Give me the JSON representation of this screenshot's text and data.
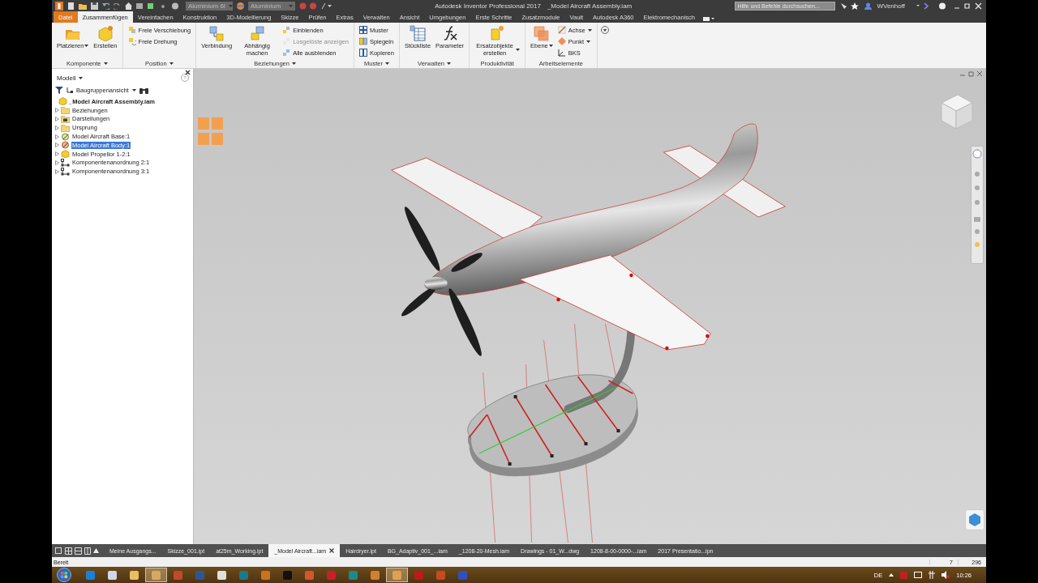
{
  "window": {
    "title": "Autodesk Inventor Professional 2017",
    "document": "_Model Aircraft Assembly.iam"
  },
  "quick_access": {
    "material": "Aluminium 6l",
    "appearance": "Aluminium"
  },
  "search": {
    "placeholder": "Hilfe und Befehle durchsuchen..."
  },
  "user": {
    "name": "WVenhoff"
  },
  "tabs": [
    {
      "label": "Datei",
      "kind": "file",
      "selected": false
    },
    {
      "label": "Zusammenfügen",
      "kind": "tab",
      "selected": true
    },
    {
      "label": "Vereinfachen",
      "kind": "tab",
      "selected": false
    },
    {
      "label": "Konstruktion",
      "kind": "tab",
      "selected": false
    },
    {
      "label": "3D-Modellierung",
      "kind": "tab",
      "selected": false
    },
    {
      "label": "Skizze",
      "kind": "tab",
      "selected": false
    },
    {
      "label": "Prüfen",
      "kind": "tab",
      "selected": false
    },
    {
      "label": "Extras",
      "kind": "tab",
      "selected": false
    },
    {
      "label": "Verwalten",
      "kind": "tab",
      "selected": false
    },
    {
      "label": "Ansicht",
      "kind": "tab",
      "selected": false
    },
    {
      "label": "Umgebungen",
      "kind": "tab",
      "selected": false
    },
    {
      "label": "Erste Schritte",
      "kind": "tab",
      "selected": false
    },
    {
      "label": "Zusatzmodule",
      "kind": "tab",
      "selected": false
    },
    {
      "label": "Vault",
      "kind": "tab",
      "selected": false
    },
    {
      "label": "Autodesk A360",
      "kind": "tab",
      "selected": false
    },
    {
      "label": "Elektromechanisch",
      "kind": "tab",
      "selected": false
    }
  ],
  "ribbon": {
    "panels": [
      {
        "title": "Komponente",
        "dropdown": true,
        "tools": [
          {
            "label": "Platzieren",
            "kind": "large",
            "dropdown": true,
            "disabled": false
          },
          {
            "label": "Erstellen",
            "kind": "large",
            "dropdown": false,
            "disabled": false
          }
        ]
      },
      {
        "title": "Position",
        "dropdown": true,
        "tools": [
          {
            "label": "Freie Verschiebung",
            "kind": "small",
            "dropdown": false,
            "disabled": false
          },
          {
            "label": "Freie Drehung",
            "kind": "small",
            "dropdown": false,
            "disabled": false
          }
        ]
      },
      {
        "title": "Beziehungen",
        "dropdown": true,
        "tools": [
          {
            "label": "Verbindung",
            "kind": "large",
            "dropdown": false,
            "disabled": false
          },
          {
            "label": "Abhängig machen",
            "kind": "large",
            "dropdown": false,
            "disabled": false
          },
          {
            "label": "Einblenden",
            "kind": "small",
            "dropdown": false,
            "disabled": false
          },
          {
            "label": "Losgelöste anzeigen",
            "kind": "small",
            "dropdown": false,
            "disabled": true
          },
          {
            "label": "Alle ausblenden",
            "kind": "small",
            "dropdown": false,
            "disabled": false
          }
        ]
      },
      {
        "title": "Muster",
        "dropdown": true,
        "tools": [
          {
            "label": "Muster",
            "kind": "small",
            "dropdown": false,
            "disabled": false
          },
          {
            "label": "Spiegeln",
            "kind": "small",
            "dropdown": false,
            "disabled": false
          },
          {
            "label": "Kopieren",
            "kind": "small",
            "dropdown": false,
            "disabled": false
          }
        ]
      },
      {
        "title": "Verwalten",
        "dropdown": true,
        "tools": [
          {
            "label": "Stückliste",
            "kind": "large",
            "dropdown": false,
            "disabled": false
          },
          {
            "label": "Parameter",
            "kind": "large",
            "dropdown": false,
            "disabled": false
          }
        ]
      },
      {
        "title": "Produktivität",
        "dropdown": false,
        "tools": [
          {
            "label": "Ersatzobjekte erstellen",
            "kind": "large",
            "dropdown": true,
            "disabled": false
          }
        ]
      },
      {
        "title": "Arbeitselemente",
        "dropdown": false,
        "tools": [
          {
            "label": "Ebene",
            "kind": "large",
            "dropdown": true,
            "disabled": false
          },
          {
            "label": "Achse",
            "kind": "small",
            "dropdown": true,
            "disabled": false
          },
          {
            "label": "Punkt",
            "kind": "small",
            "dropdown": true,
            "disabled": false
          },
          {
            "label": "BKS",
            "kind": "small",
            "dropdown": false,
            "disabled": false
          }
        ]
      }
    ]
  },
  "browser": {
    "title": "Modell",
    "help": "?",
    "view": "Baugruppenansicht",
    "tree": {
      "label": "_Model Aircraft Assembly.iam",
      "children": [
        {
          "label": "Beziehungen",
          "kind": "folder",
          "expanded": false,
          "selected": false
        },
        {
          "label": "Darstellungen",
          "kind": "representations",
          "expanded": false,
          "selected": false
        },
        {
          "label": "Ursprung",
          "kind": "folder",
          "expanded": false,
          "selected": false
        },
        {
          "label": "Model Aircraft Base:1",
          "kind": "part",
          "expanded": false,
          "selected": false
        },
        {
          "label": "Model Aircraft Body:1",
          "kind": "active",
          "expanded": false,
          "selected": true
        },
        {
          "label": "Model Propellor 1-2:1",
          "kind": "assembly",
          "expanded": false,
          "selected": false
        },
        {
          "label": "Komponentenanordnung 2:1",
          "kind": "pattern",
          "expanded": false,
          "selected": false
        },
        {
          "label": "Komponentenanordnung 3:1",
          "kind": "pattern",
          "expanded": false,
          "selected": false
        }
      ]
    }
  },
  "documents": [
    {
      "label": "Meine Ausgangs...",
      "selected": false
    },
    {
      "label": "Skizze_001.ipt",
      "selected": false
    },
    {
      "label": "at25m_Working.ipt",
      "selected": false
    },
    {
      "label": "_Model Aircraft...iam",
      "selected": true
    },
    {
      "label": "Hairdryer.ipt",
      "selected": false
    },
    {
      "label": "BG_Adaptiv_001_...iam",
      "selected": false
    },
    {
      "label": "_1208-20-Mesh.iam",
      "selected": false
    },
    {
      "label": "Drawings - 01_W...dwg",
      "selected": false
    },
    {
      "label": "1208-8-00-0000-...iam",
      "selected": false
    },
    {
      "label": "2017 Presentatio...ipn",
      "selected": false
    }
  ],
  "status_bar": {
    "text": "Bereit",
    "values": [
      "7",
      "296"
    ]
  },
  "taskbar": {
    "apps": [
      {
        "color": "#1e7fd8",
        "selected": false
      },
      {
        "color": "#cfd8e8",
        "selected": false
      },
      {
        "color": "#e8c060",
        "selected": false
      },
      {
        "color": "#d8a860",
        "selected": true
      },
      {
        "color": "#c04a2a",
        "selected": false
      },
      {
        "color": "#2b5797",
        "selected": false
      },
      {
        "color": "#e0e0e0",
        "selected": false
      },
      {
        "color": "#1a7a8a",
        "selected": false
      },
      {
        "color": "#c9731e",
        "selected": false
      },
      {
        "color": "#111111",
        "selected": false
      },
      {
        "color": "#d2572a",
        "selected": false
      },
      {
        "color": "#c8202a",
        "selected": false
      },
      {
        "color": "#1a8a8a",
        "selected": false
      },
      {
        "color": "#d08030",
        "selected": false
      },
      {
        "color": "#e0a050",
        "selected": true
      },
      {
        "color": "#c01818",
        "selected": false
      },
      {
        "color": "#c84a20",
        "selected": false
      },
      {
        "color": "#3050c0",
        "selected": false
      }
    ],
    "language": "DE",
    "time": "10:26"
  }
}
